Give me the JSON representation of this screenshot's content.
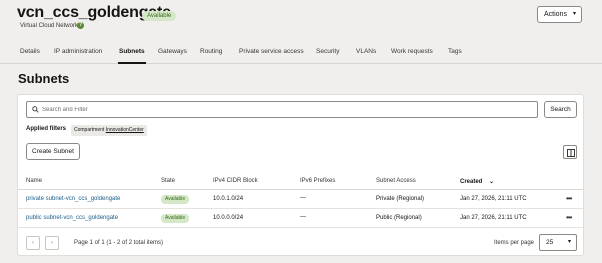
{
  "header": {
    "title": "vcn_ccs_goldengate",
    "status": "Available",
    "subtitle": "Virtual Cloud Network",
    "actions_label": "Actions",
    "actions_icon": "chevron-down-icon",
    "help_icon": "help-icon"
  },
  "tabs": [
    {
      "label": "Details"
    },
    {
      "label": "IP administration"
    },
    {
      "label": "Subnets",
      "active": true
    },
    {
      "label": "Gateways"
    },
    {
      "label": "Routing"
    },
    {
      "label": "Private service access"
    },
    {
      "label": "Security"
    },
    {
      "label": "VLANs"
    },
    {
      "label": "Work requests"
    },
    {
      "label": "Tags"
    }
  ],
  "section": {
    "title": "Subnets"
  },
  "search": {
    "placeholder": "Search and Filter",
    "value": "",
    "button_label": "Search",
    "icon": "search-icon"
  },
  "filters": {
    "label": "Applied filters",
    "chip_key": "Compartment",
    "chip_value": "InnovationCenter"
  },
  "toolbar": {
    "create_label": "Create Subnet",
    "panel_icon": "columns-icon"
  },
  "table": {
    "columns": [
      "Name",
      "State",
      "IPv4 CIDR Block",
      "IPv6 Prefixes",
      "Subnet Access",
      "Created"
    ],
    "sort_icon": "chevron-down-icon",
    "rows": [
      {
        "name": "private subnet-vcn_ccs_goldengate",
        "state": "Available",
        "ipv4": "10.0.1.0/24",
        "ipv6": "—",
        "access": "Private (Regional)",
        "created": "Jan 27, 2026, 21:11 UTC",
        "menu": "•••"
      },
      {
        "name": "public subnet-vcn_ccs_goldengate",
        "state": "Available",
        "ipv4": "10.0.0.0/24",
        "ipv6": "—",
        "access": "Public (Regional)",
        "created": "Jan 27, 2026, 21:11 UTC",
        "menu": "•••"
      }
    ]
  },
  "pagination": {
    "prev_icon": "chevron-left-icon",
    "next_icon": "chevron-right-icon",
    "summary": "Page 1 of 1 (1 - 2 of 2 total items)",
    "items_per_page_label": "Items per page",
    "items_per_page_value": "25"
  },
  "colors": {
    "accent_link": "#1a5e8a",
    "status_green": "#d4e7c6",
    "page_bg": "#f1efed"
  }
}
